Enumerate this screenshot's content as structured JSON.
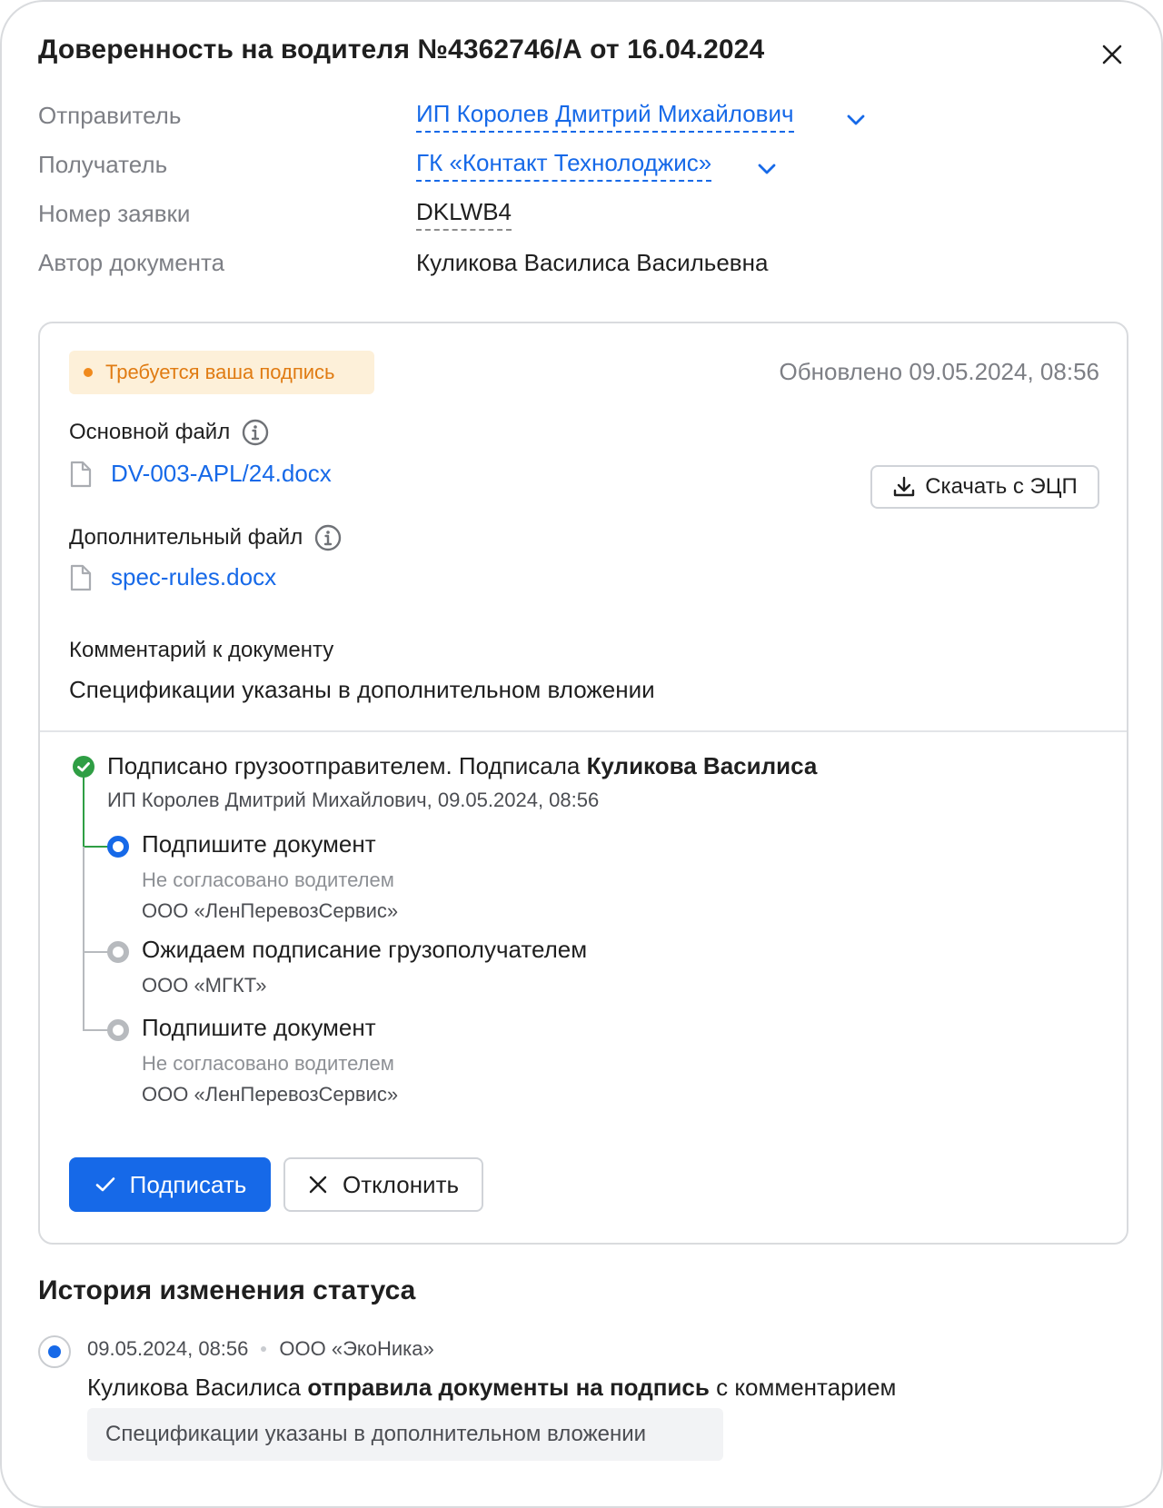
{
  "header": {
    "title": "Доверенность на водителя №4362746/А от 16.04.2024"
  },
  "meta": {
    "sender_label": "Отправитель",
    "sender_value": "ИП Королев Дмитрий Михайлович",
    "recipient_label": "Получатель",
    "recipient_value": "ГК «Контакт Технолоджис»",
    "request_label": "Номер заявки",
    "request_value": "DKLWB4",
    "author_label": "Автор документа",
    "author_value": "Куликова Василиса Васильевна"
  },
  "card": {
    "badge": "Требуется ваша подпись",
    "updated": "Обновлено 09.05.2024, 08:56",
    "main_file_label": "Основной файл",
    "main_file_name": "DV-003-APL/24.docx",
    "download_button": "Скачать с ЭЦП",
    "extra_file_label": "Дополнительный файл",
    "extra_file_name": "spec-rules.docx",
    "comment_label": "Комментарий к документу",
    "comment_text": "Спецификации указаны в дополнительном вложении"
  },
  "timeline": {
    "step1_text": "Подписано грузоотправителем. Подписала ",
    "step1_name": "Куликова Василиса",
    "step1_sub": "ИП Королев Дмитрий Михайлович, 09.05.2024, 08:56",
    "step2_title": "Подпишите документ",
    "step2_status": "Не согласовано водителем",
    "step2_org": "ООО «ЛенПеревозСервис»",
    "step3_title": "Ожидаем подписание грузополучателем",
    "step3_org": "ООО «МГКТ»",
    "step4_title": "Подпишите документ",
    "step4_status": "Не согласовано водителем",
    "step4_org": "ООО «ЛенПеревозСервис»"
  },
  "actions": {
    "sign": "Подписать",
    "reject": "Отклонить"
  },
  "history": {
    "title": "История изменения статуса",
    "date": "09.05.2024, 08:56",
    "org": "ООО «ЭкоНика»",
    "actor": "Куликова Василиса",
    "action": "отправила документы на подпись",
    "suffix": "с комментарием",
    "comment": "Спецификации указаны в дополнительном вложении"
  },
  "colors": {
    "accent": "#1669e8",
    "warning": "#e07b12",
    "success": "#2f9e44"
  }
}
